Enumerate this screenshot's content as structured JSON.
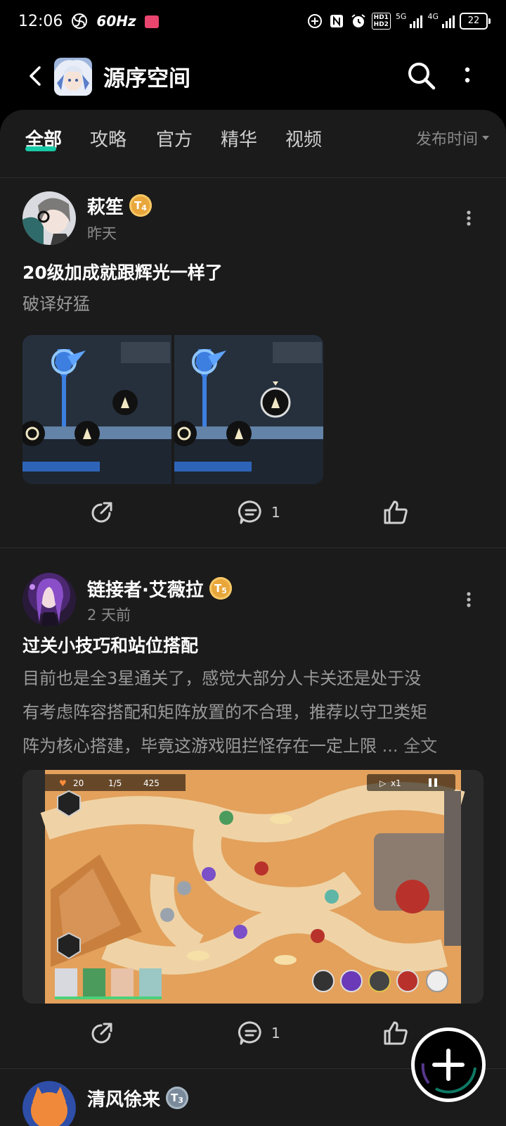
{
  "status_bar": {
    "time": "12:06",
    "refresh_rate": "60Hz",
    "network_5g": "5G",
    "network_4g": "4G",
    "hd_label": "HD",
    "battery": "22"
  },
  "header": {
    "title": "源序空间",
    "avatar_icon": "club-avatar"
  },
  "tabs": [
    {
      "label": "全部",
      "active": true
    },
    {
      "label": "攻略",
      "active": false
    },
    {
      "label": "官方",
      "active": false
    },
    {
      "label": "精华",
      "active": false
    },
    {
      "label": "视频",
      "active": false
    }
  ],
  "sort": {
    "label": "发布时间"
  },
  "posts": [
    {
      "author": "萩笙",
      "level": "4",
      "time": "昨天",
      "title": "20级加成就跟辉光一样了",
      "excerpt": "破译好猛",
      "image_count": 2,
      "comments": "1"
    },
    {
      "author": "链接者·艾薇拉",
      "level": "5",
      "time": "2 天前",
      "title": "过关小技巧和站位搭配",
      "excerpt_lines": [
        "目前也是全3星通关了，感觉大部分人卡关还是处于没",
        "有考虑阵容搭配和矩阵放置的不合理，推荐以守卫类矩",
        "阵为核心搭建，毕竟这游戏阻拦怪存在一定上限"
      ],
      "ellipsis": " ... ",
      "full_text_label": "全文",
      "hud": {
        "hp": "20",
        "wave": "1/5",
        "coins": "425",
        "speed": "x1"
      },
      "comments": "1"
    },
    {
      "author": "清风徐来",
      "level": "3"
    }
  ],
  "colors": {
    "accent": "#16c9a6",
    "badge_gold": "#e9a63a",
    "background": "#1b1b1b"
  }
}
